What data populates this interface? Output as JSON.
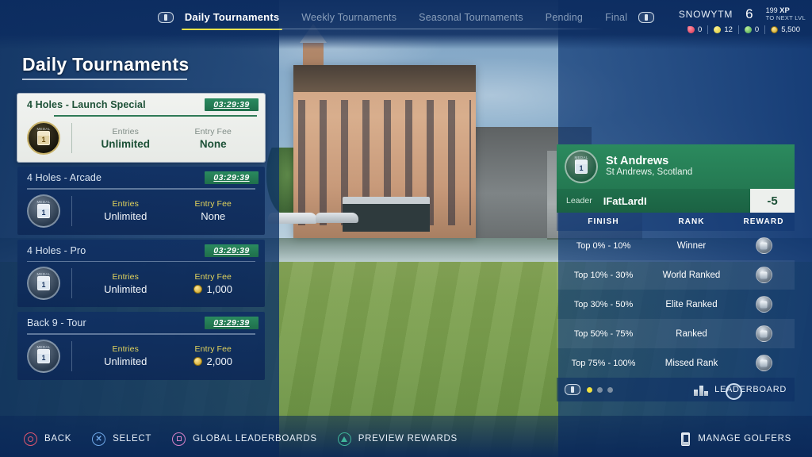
{
  "topnav": {
    "left_bumper_icon": "l1-shoulder-button-icon",
    "right_bumper_icon": "r1-shoulder-button-icon",
    "tabs": [
      {
        "label": "Daily Tournaments",
        "active": true
      },
      {
        "label": "Weekly Tournaments",
        "active": false
      },
      {
        "label": "Seasonal Tournaments",
        "active": false
      },
      {
        "label": "Pending",
        "active": false
      },
      {
        "label": "Final",
        "active": false
      }
    ]
  },
  "player": {
    "name": "SNOWYTM",
    "level": "6",
    "xp_amount": "199",
    "xp_unit": "XP",
    "xp_sub": "TO NEXT LVL",
    "currencies": [
      {
        "icon": "red-gem-icon",
        "value": "0"
      },
      {
        "icon": "yellow-ball-icon",
        "value": "12"
      },
      {
        "icon": "green-ball-icon",
        "value": "0"
      },
      {
        "icon": "gold-coin-icon",
        "value": "5,500"
      }
    ]
  },
  "page": {
    "title": "Daily Tournaments"
  },
  "tournaments": [
    {
      "name": "4 Holes - Launch Special",
      "timer": "03:29:39",
      "selected": true,
      "badge_top": "MEDAL",
      "badge_num": "1",
      "entries_label": "Entries",
      "entries_value": "Unlimited",
      "fee_label": "Entry Fee",
      "fee_value": "None",
      "fee_has_coin": false
    },
    {
      "name": "4 Holes - Arcade",
      "timer": "03:29:39",
      "selected": false,
      "badge_top": "MEDAL",
      "badge_num": "1",
      "entries_label": "Entries",
      "entries_value": "Unlimited",
      "fee_label": "Entry Fee",
      "fee_value": "None",
      "fee_has_coin": false
    },
    {
      "name": "4 Holes - Pro",
      "timer": "03:29:39",
      "selected": false,
      "badge_top": "MEDAL",
      "badge_num": "1",
      "entries_label": "Entries",
      "entries_value": "Unlimited",
      "fee_label": "Entry Fee",
      "fee_value": "1,000",
      "fee_has_coin": true
    },
    {
      "name": "Back 9 - Tour",
      "timer": "03:29:39",
      "selected": false,
      "badge_top": "MEDAL",
      "badge_num": "1",
      "entries_label": "Entries",
      "entries_value": "Unlimited",
      "fee_label": "Entry Fee",
      "fee_value": "2,000",
      "fee_has_coin": true
    }
  ],
  "panel": {
    "course_name": "St Andrews",
    "course_location": "St Andrews, Scotland",
    "course_badge_icon": "course-medal-icon",
    "leader_label": "Leader",
    "leader_name": "IFatLardI",
    "leader_score": "-5",
    "table_headers": {
      "finish": "FINISH",
      "rank": "RANK",
      "reward": "REWARD"
    },
    "rows": [
      {
        "finish": "Top 0% - 10%",
        "rank": "Winner",
        "reward_icon": "silver-trophy-icon"
      },
      {
        "finish": "Top 10% - 30%",
        "rank": "World Ranked",
        "reward_icon": "silver-trophy-icon"
      },
      {
        "finish": "Top 30% - 50%",
        "rank": "Elite Ranked",
        "reward_icon": "silver-trophy-icon"
      },
      {
        "finish": "Top 50% - 75%",
        "rank": "Ranked",
        "reward_icon": "silver-trophy-icon"
      },
      {
        "finish": "Top 75% - 100%",
        "rank": "Missed Rank",
        "reward_icon": "silver-trophy-icon"
      }
    ],
    "pager": {
      "total": 3,
      "active_index": 0
    },
    "leaderboard_label": "LEADERBOARD",
    "leaderboard_icon": "podium-icon",
    "pager_button_icon": "r3-stick-button-icon"
  },
  "bottombar": {
    "actions": [
      {
        "button": "circle",
        "label": "BACK"
      },
      {
        "button": "cross",
        "label": "SELECT"
      },
      {
        "button": "square",
        "label": "GLOBAL LEADERBOARDS"
      },
      {
        "button": "triangle",
        "label": "PREVIEW REWARDS"
      }
    ],
    "manage": {
      "icon": "phone-icon",
      "label": "MANAGE GOLFERS"
    }
  },
  "colors": {
    "accent_yellow": "#e7e24a",
    "green_header": "#2b8a5e",
    "timer_green": "#1f6f4b",
    "panel_blue": "#0d346e",
    "selected_card_bg": "#f1f3f0",
    "selected_card_text": "#1d5137"
  }
}
